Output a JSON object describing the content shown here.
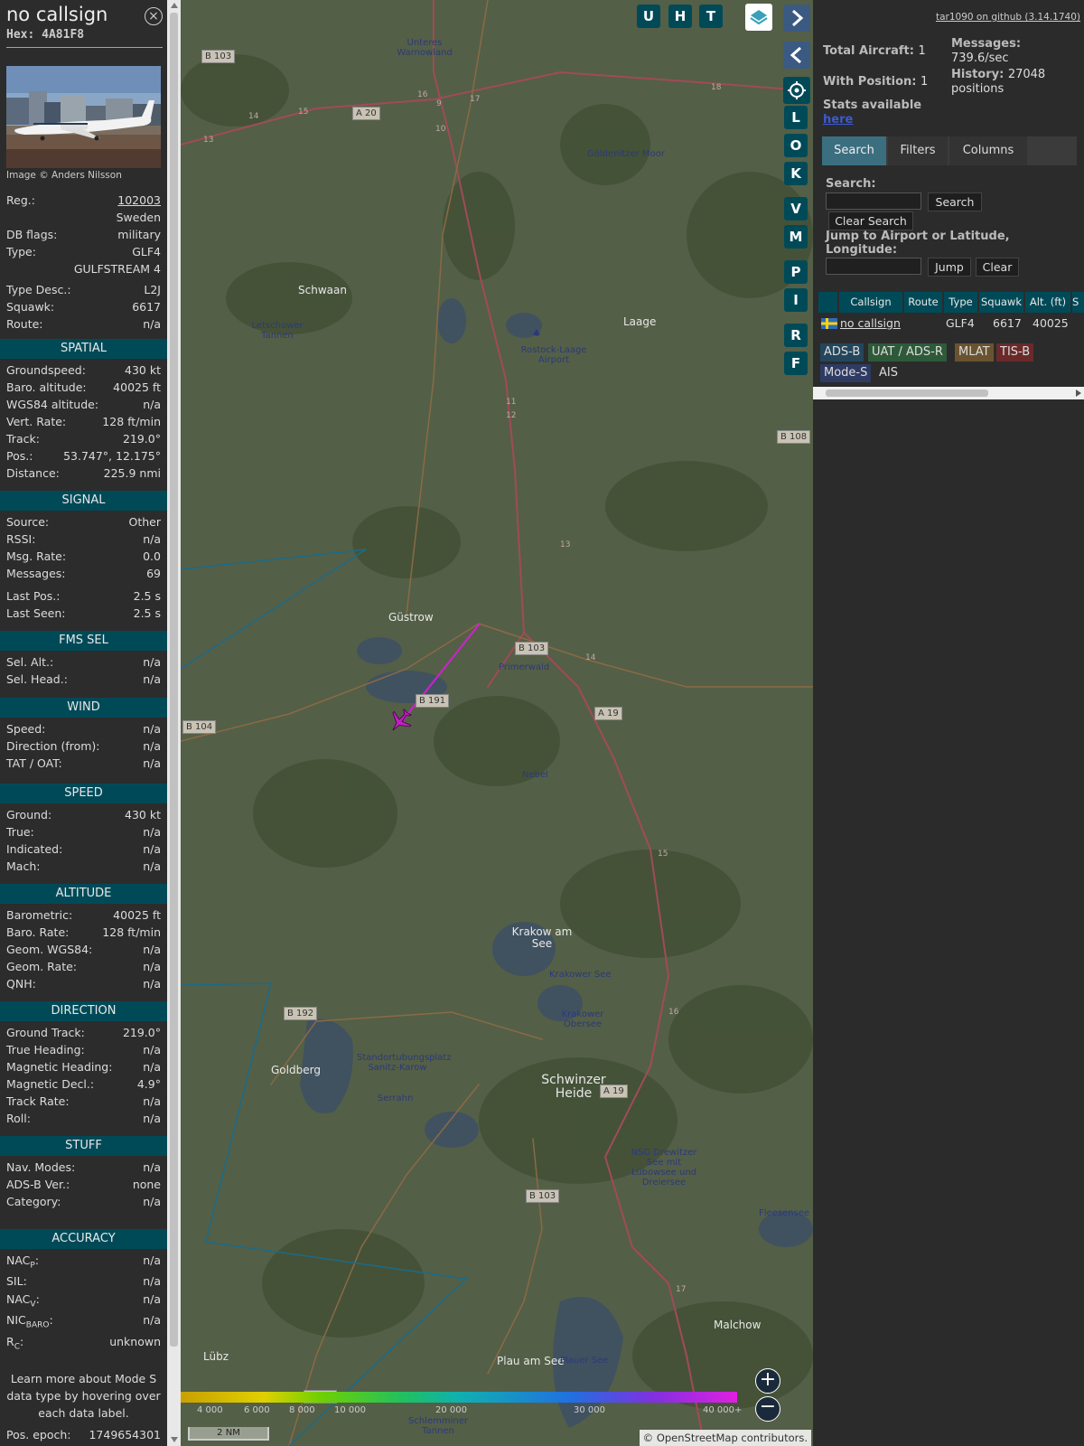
{
  "aircraft": {
    "callsign": "no callsign",
    "hex_label": "Hex:",
    "hex": "4A81F8",
    "photo_credit": "Image © Anders Nilsson",
    "reg_label": "Reg.:",
    "reg": "102003",
    "country": "Sweden",
    "dbflags_label": "DB flags:",
    "dbflags": "military",
    "type_label": "Type:",
    "type": "GLF4",
    "type_full": "GULFSTREAM 4",
    "typedesc_label": "Type Desc.:",
    "typedesc": "L2J",
    "squawk_label": "Squawk:",
    "squawk": "6617",
    "route_label": "Route:",
    "route": "n/a"
  },
  "sections": {
    "spatial": {
      "title": "SPATIAL",
      "rows": [
        {
          "k": "Groundspeed:",
          "v": "430 kt"
        },
        {
          "k": "Baro. altitude:",
          "v": "40025 ft"
        },
        {
          "k": "WGS84 altitude:",
          "v": "n/a"
        },
        {
          "k": "Vert. Rate:",
          "v": "128 ft/min"
        },
        {
          "k": "Track:",
          "v": "219.0°"
        },
        {
          "k": "Pos.:",
          "v": "53.747°, 12.175°"
        },
        {
          "k": "Distance:",
          "v": "225.9 nmi"
        }
      ]
    },
    "signal": {
      "title": "SIGNAL",
      "rows": [
        {
          "k": "Source:",
          "v": "Other"
        },
        {
          "k": "RSSI:",
          "v": "n/a"
        },
        {
          "k": "Msg. Rate:",
          "v": "0.0"
        },
        {
          "k": "Messages:",
          "v": "69"
        },
        {
          "k": "Last Pos.:",
          "v": "2.5 s"
        },
        {
          "k": "Last Seen:",
          "v": "2.5 s"
        }
      ]
    },
    "fms": {
      "title": "FMS SEL",
      "rows": [
        {
          "k": "Sel. Alt.:",
          "v": "n/a"
        },
        {
          "k": "Sel. Head.:",
          "v": "n/a"
        }
      ]
    },
    "wind": {
      "title": "WIND",
      "rows": [
        {
          "k": "Speed:",
          "v": "n/a"
        },
        {
          "k": "Direction (from):",
          "v": "n/a"
        },
        {
          "k": "TAT / OAT:",
          "v": "n/a"
        }
      ]
    },
    "speed": {
      "title": "SPEED",
      "rows": [
        {
          "k": "Ground:",
          "v": "430 kt"
        },
        {
          "k": "True:",
          "v": "n/a"
        },
        {
          "k": "Indicated:",
          "v": "n/a"
        },
        {
          "k": "Mach:",
          "v": "n/a"
        }
      ]
    },
    "altitude": {
      "title": "ALTITUDE",
      "rows": [
        {
          "k": "Barometric:",
          "v": "40025 ft"
        },
        {
          "k": "Baro. Rate:",
          "v": "128 ft/min"
        },
        {
          "k": "Geom. WGS84:",
          "v": "n/a"
        },
        {
          "k": "Geom. Rate:",
          "v": "n/a"
        },
        {
          "k": "QNH:",
          "v": "n/a"
        }
      ]
    },
    "direction": {
      "title": "DIRECTION",
      "rows": [
        {
          "k": "Ground Track:",
          "v": "219.0°"
        },
        {
          "k": "True Heading:",
          "v": "n/a"
        },
        {
          "k": "Magnetic Heading:",
          "v": "n/a"
        },
        {
          "k": "Magnetic Decl.:",
          "v": "4.9°"
        },
        {
          "k": "Track Rate:",
          "v": "n/a"
        },
        {
          "k": "Roll:",
          "v": "n/a"
        }
      ]
    },
    "stuff": {
      "title": "STUFF",
      "rows": [
        {
          "k": "Nav. Modes:",
          "v": "n/a"
        },
        {
          "k": "ADS-B Ver.:",
          "v": "none"
        },
        {
          "k": "Category:",
          "v": "n/a"
        }
      ]
    },
    "accuracy": {
      "title": "ACCURACY",
      "rows": [
        {
          "k": "NAC",
          "sub": "P",
          "k2": ":",
          "v": "n/a"
        },
        {
          "k": "SIL:",
          "v": "n/a"
        },
        {
          "k": "NAC",
          "sub": "V",
          "k2": ":",
          "v": "n/a"
        },
        {
          "k": "NIC",
          "sub": "BARO",
          "k2": ":",
          "v": "n/a"
        },
        {
          "k": "R",
          "sub": "C",
          "k2": ":",
          "v": "unknown"
        }
      ]
    },
    "note": "Learn more about Mode S data type by hovering over each data label.",
    "epoch_label": "Pos. epoch:",
    "epoch": "1749654301"
  },
  "map": {
    "buttons": [
      "U",
      "H",
      "T"
    ],
    "side_buttons": [
      "L",
      "O",
      "K",
      "V",
      "M",
      "P",
      "I",
      "R",
      "F"
    ],
    "attribution": "© OpenStreetMap contributors.",
    "scale": "2 NM",
    "altitude_legend": [
      "4 000",
      "6 000",
      "8 000",
      "10 000",
      "20 000",
      "30 000",
      "40 000+"
    ],
    "places": [
      {
        "name": "Schwaan"
      },
      {
        "name": "Laage"
      },
      {
        "name": "Rostock-Laage Airport"
      },
      {
        "name": "Güstrow"
      },
      {
        "name": "Krakow am See"
      },
      {
        "name": "Goldberg"
      },
      {
        "name": "Schwinzer Heide"
      },
      {
        "name": "Malchow"
      },
      {
        "name": "Lübz"
      },
      {
        "name": "Plau am See"
      },
      {
        "name": "Primerwald"
      },
      {
        "name": "Nebel"
      },
      {
        "name": "Unteres Warnowland"
      },
      {
        "name": "Göldenitzer Moor"
      },
      {
        "name": "Letschower Tannen"
      },
      {
        "name": "Standortubungsplatz Sanitz-Karow"
      },
      {
        "name": "Serrahn"
      },
      {
        "name": "Krakower See"
      },
      {
        "name": "Krakower Obersee"
      },
      {
        "name": "NSG Drewitzer See mit Lübowsee und Dreiersee"
      },
      {
        "name": "Plauer See"
      },
      {
        "name": "Fleesensee"
      },
      {
        "name": "Schlemminer Tannen"
      }
    ],
    "roads": [
      "B 103",
      "A 20",
      "B 104",
      "A 19",
      "B 192",
      "B 191",
      "B 108"
    ],
    "road_numbers": [
      "14",
      "15",
      "13",
      "16",
      "9",
      "17",
      "18",
      "10",
      "11",
      "12",
      "13",
      "14",
      "15",
      "16",
      "17"
    ]
  },
  "right": {
    "github_link": "tar1090 on github (3.14.1740)",
    "total_label": "Total Aircraft:",
    "total": "1",
    "withpos_label": "With Position:",
    "withpos": "1",
    "stats_label": "Stats available",
    "stats_link": "here",
    "messages_label": "Messages:",
    "messages": "739.6/sec",
    "history_label": "History:",
    "history_a": "27048",
    "history_b": "positions",
    "tabs": [
      "Search",
      "Filters",
      "Columns"
    ],
    "search_label": "Search:",
    "search_btn": "Search",
    "clear_search_btn": "Clear Search",
    "jump_label": "Jump to Airport or Latitude, Longitude:",
    "jump_btn": "Jump",
    "clear_btn": "Clear",
    "table_headers": [
      "Callsign",
      "Route",
      "Type",
      "Squawk",
      "Alt. (ft)",
      "S"
    ],
    "table_row": {
      "callsign": "no callsign",
      "route": "",
      "type": "GLF4",
      "squawk": "6617",
      "alt": "40025"
    },
    "badges": [
      {
        "label": "ADS-B",
        "color": "#23465c"
      },
      {
        "label": "UAT / ADS-R",
        "color": "#2e5a3a"
      },
      {
        "label": "MLAT",
        "color": "#6a5330"
      },
      {
        "label": "TIS-B",
        "color": "#6a2a2a"
      },
      {
        "label": "Mode-S",
        "color": "#2e3b63"
      },
      {
        "label": "AIS",
        "color": ""
      }
    ]
  }
}
